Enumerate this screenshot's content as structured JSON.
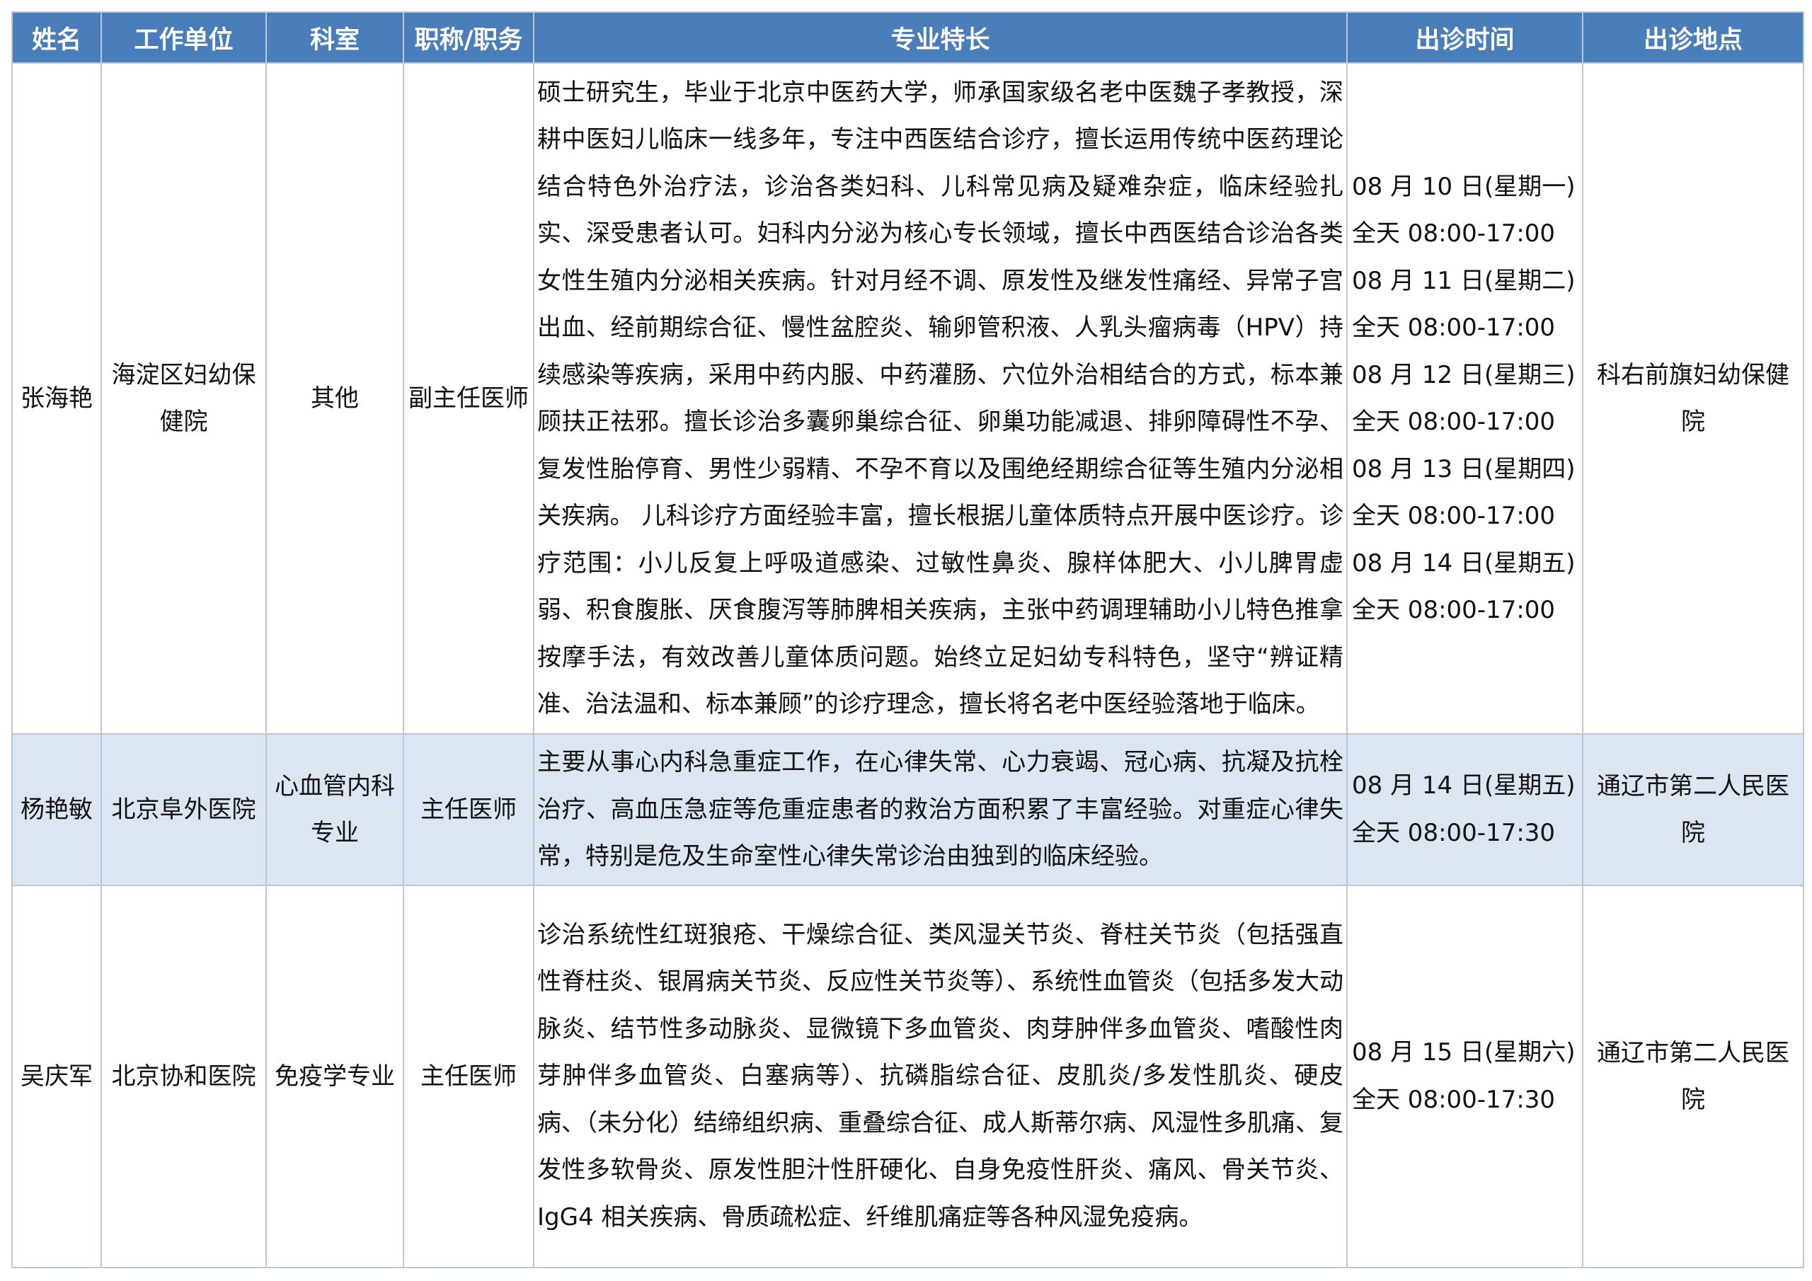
{
  "columns": [
    "姓名",
    "工作单位",
    "科室",
    "职称/职务",
    "专业特长",
    "出诊时间",
    "出诊地点"
  ],
  "rows": [
    {
      "name": "张海艳",
      "unit": "海淀区妇幼保健院",
      "dept": "其他",
      "title": "副主任医师",
      "specialty": "硕士研究生，毕业于北京中医药大学，师承国家级名老中医魏子孝教授，深耕中医妇儿临床一线多年，专注中西医结合诊疗，擅长运用传统中医药理论结合特色外治疗法，诊治各类妇科、儿科常见病及疑难杂症，临床经验扎实、深受患者认可。妇科内分泌为核心专长领域，擅长中西医结合诊治各类女性生殖内分泌相关疾病。针对月经不调、原发性及继发性痛经、异常子宫出血、经前期综合征、慢性盆腔炎、输卵管积液、人乳头瘤病毒（HPV）持续感染等疾病，采用中药内服、中药灌肠、穴位外治相结合的方式，标本兼顾扶正祛邪。擅长诊治多囊卵巢综合征、卵巢功能减退、排卵障碍性不孕、复发性胎停育、男性少弱精、不孕不育以及围绝经期综合征等生殖内分泌相关疾病。 儿科诊疗方面经验丰富，擅长根据儿童体质特点开展中医诊疗。诊疗范围：小儿反复上呼吸道感染、过敏性鼻炎、腺样体肥大、小儿脾胃虚弱、积食腹胀、厌食腹泻等肺脾相关疾病，主张中药调理辅助小儿特色推拿按摩手法，有效改善儿童体质问题。始终立足妇幼专科特色，坚守“辨证精准、治法温和、标本兼顾”的诊疗理念，擅长将名老中医经验落地于临床。",
      "schedule": [
        "08 月 10 日(星期一)",
        "全天 08:00-17:00",
        "08 月 11 日(星期二)",
        "全天 08:00-17:00",
        "08 月 12 日(星期三)",
        "全天 08:00-17:00",
        "08 月 13 日(星期四)",
        "全天 08:00-17:00",
        "08 月 14 日(星期五)",
        "全天 08:00-17:00"
      ],
      "location": "科右前旗妇幼保健院"
    },
    {
      "name": "杨艳敏",
      "unit": "北京阜外医院",
      "dept": "心血管内科专业",
      "title": "主任医师",
      "specialty": "主要从事心内科急重症工作，在心律失常、心力衰竭、冠心病、抗凝及抗栓治疗、高血压急症等危重症患者的救治方面积累了丰富经验。对重症心律失常，特别是危及生命室性心律失常诊治由独到的临床经验。",
      "schedule": [
        "08 月 14 日(星期五)",
        "全天 08:00-17:30"
      ],
      "location": "通辽市第二人民医院"
    },
    {
      "name": "吴庆军",
      "unit": "北京协和医院",
      "dept": "免疫学专业",
      "title": "主任医师",
      "specialty": "诊治系统性红斑狼疮、干燥综合征、类风湿关节炎、脊柱关节炎（包括强直性脊柱炎、银屑病关节炎、反应性关节炎等）、系统性血管炎（包括多发大动脉炎、结节性多动脉炎、显微镜下多血管炎、肉芽肿伴多血管炎、嗜酸性肉芽肿伴多血管炎、白塞病等）、抗磷脂综合征、皮肌炎/多发性肌炎、硬皮病、（未分化）结缔组织病、重叠综合征、成人斯蒂尔病、风湿性多肌痛、复发性多软骨炎、原发性胆汁性肝硬化、自身免疫性肝炎、痛风、骨关节炎、IgG4 相关疾病、骨质疏松症、纤维肌痛症等各种风湿免疫病。",
      "schedule": [
        "08 月 15 日(星期六)",
        "全天 08:00-17:30"
      ],
      "location": "通辽市第二人民医院"
    }
  ]
}
